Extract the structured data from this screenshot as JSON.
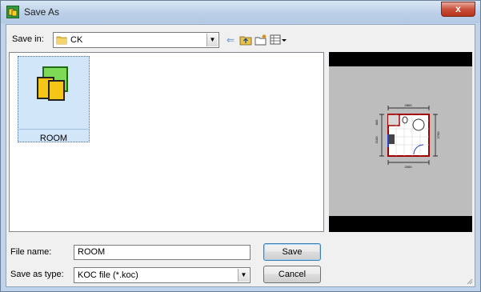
{
  "window": {
    "title": "Save As",
    "close_glyph": "x"
  },
  "save_in": {
    "label": "Save in:",
    "current_folder": "CK",
    "folder_icon": "folder-icon"
  },
  "toolbar": {
    "back_icon": "back-arrow-icon",
    "up_icon": "up-folder-icon",
    "new_folder_icon": "new-folder-icon",
    "view_menu_icon": "view-menu-icon"
  },
  "files": [
    {
      "name": "ROOM",
      "icon": "koc-file-icon",
      "selected": true
    }
  ],
  "preview": {
    "dim_top": "2800",
    "dim_bottom": "2000",
    "dim_left_upper": "800",
    "dim_left_lower": "2100",
    "dim_right": "2700"
  },
  "file_name": {
    "label": "File name:",
    "value": "ROOM"
  },
  "save_as_type": {
    "label": "Save as type:",
    "value": "KOC file (*.koc)"
  },
  "buttons": {
    "save": "Save",
    "cancel": "Cancel"
  },
  "colors": {
    "title_bar": "#bcd0e8",
    "close_button": "#c9513b",
    "selection": "#d2e6fa",
    "preview_bg": "#bdbdbd"
  }
}
